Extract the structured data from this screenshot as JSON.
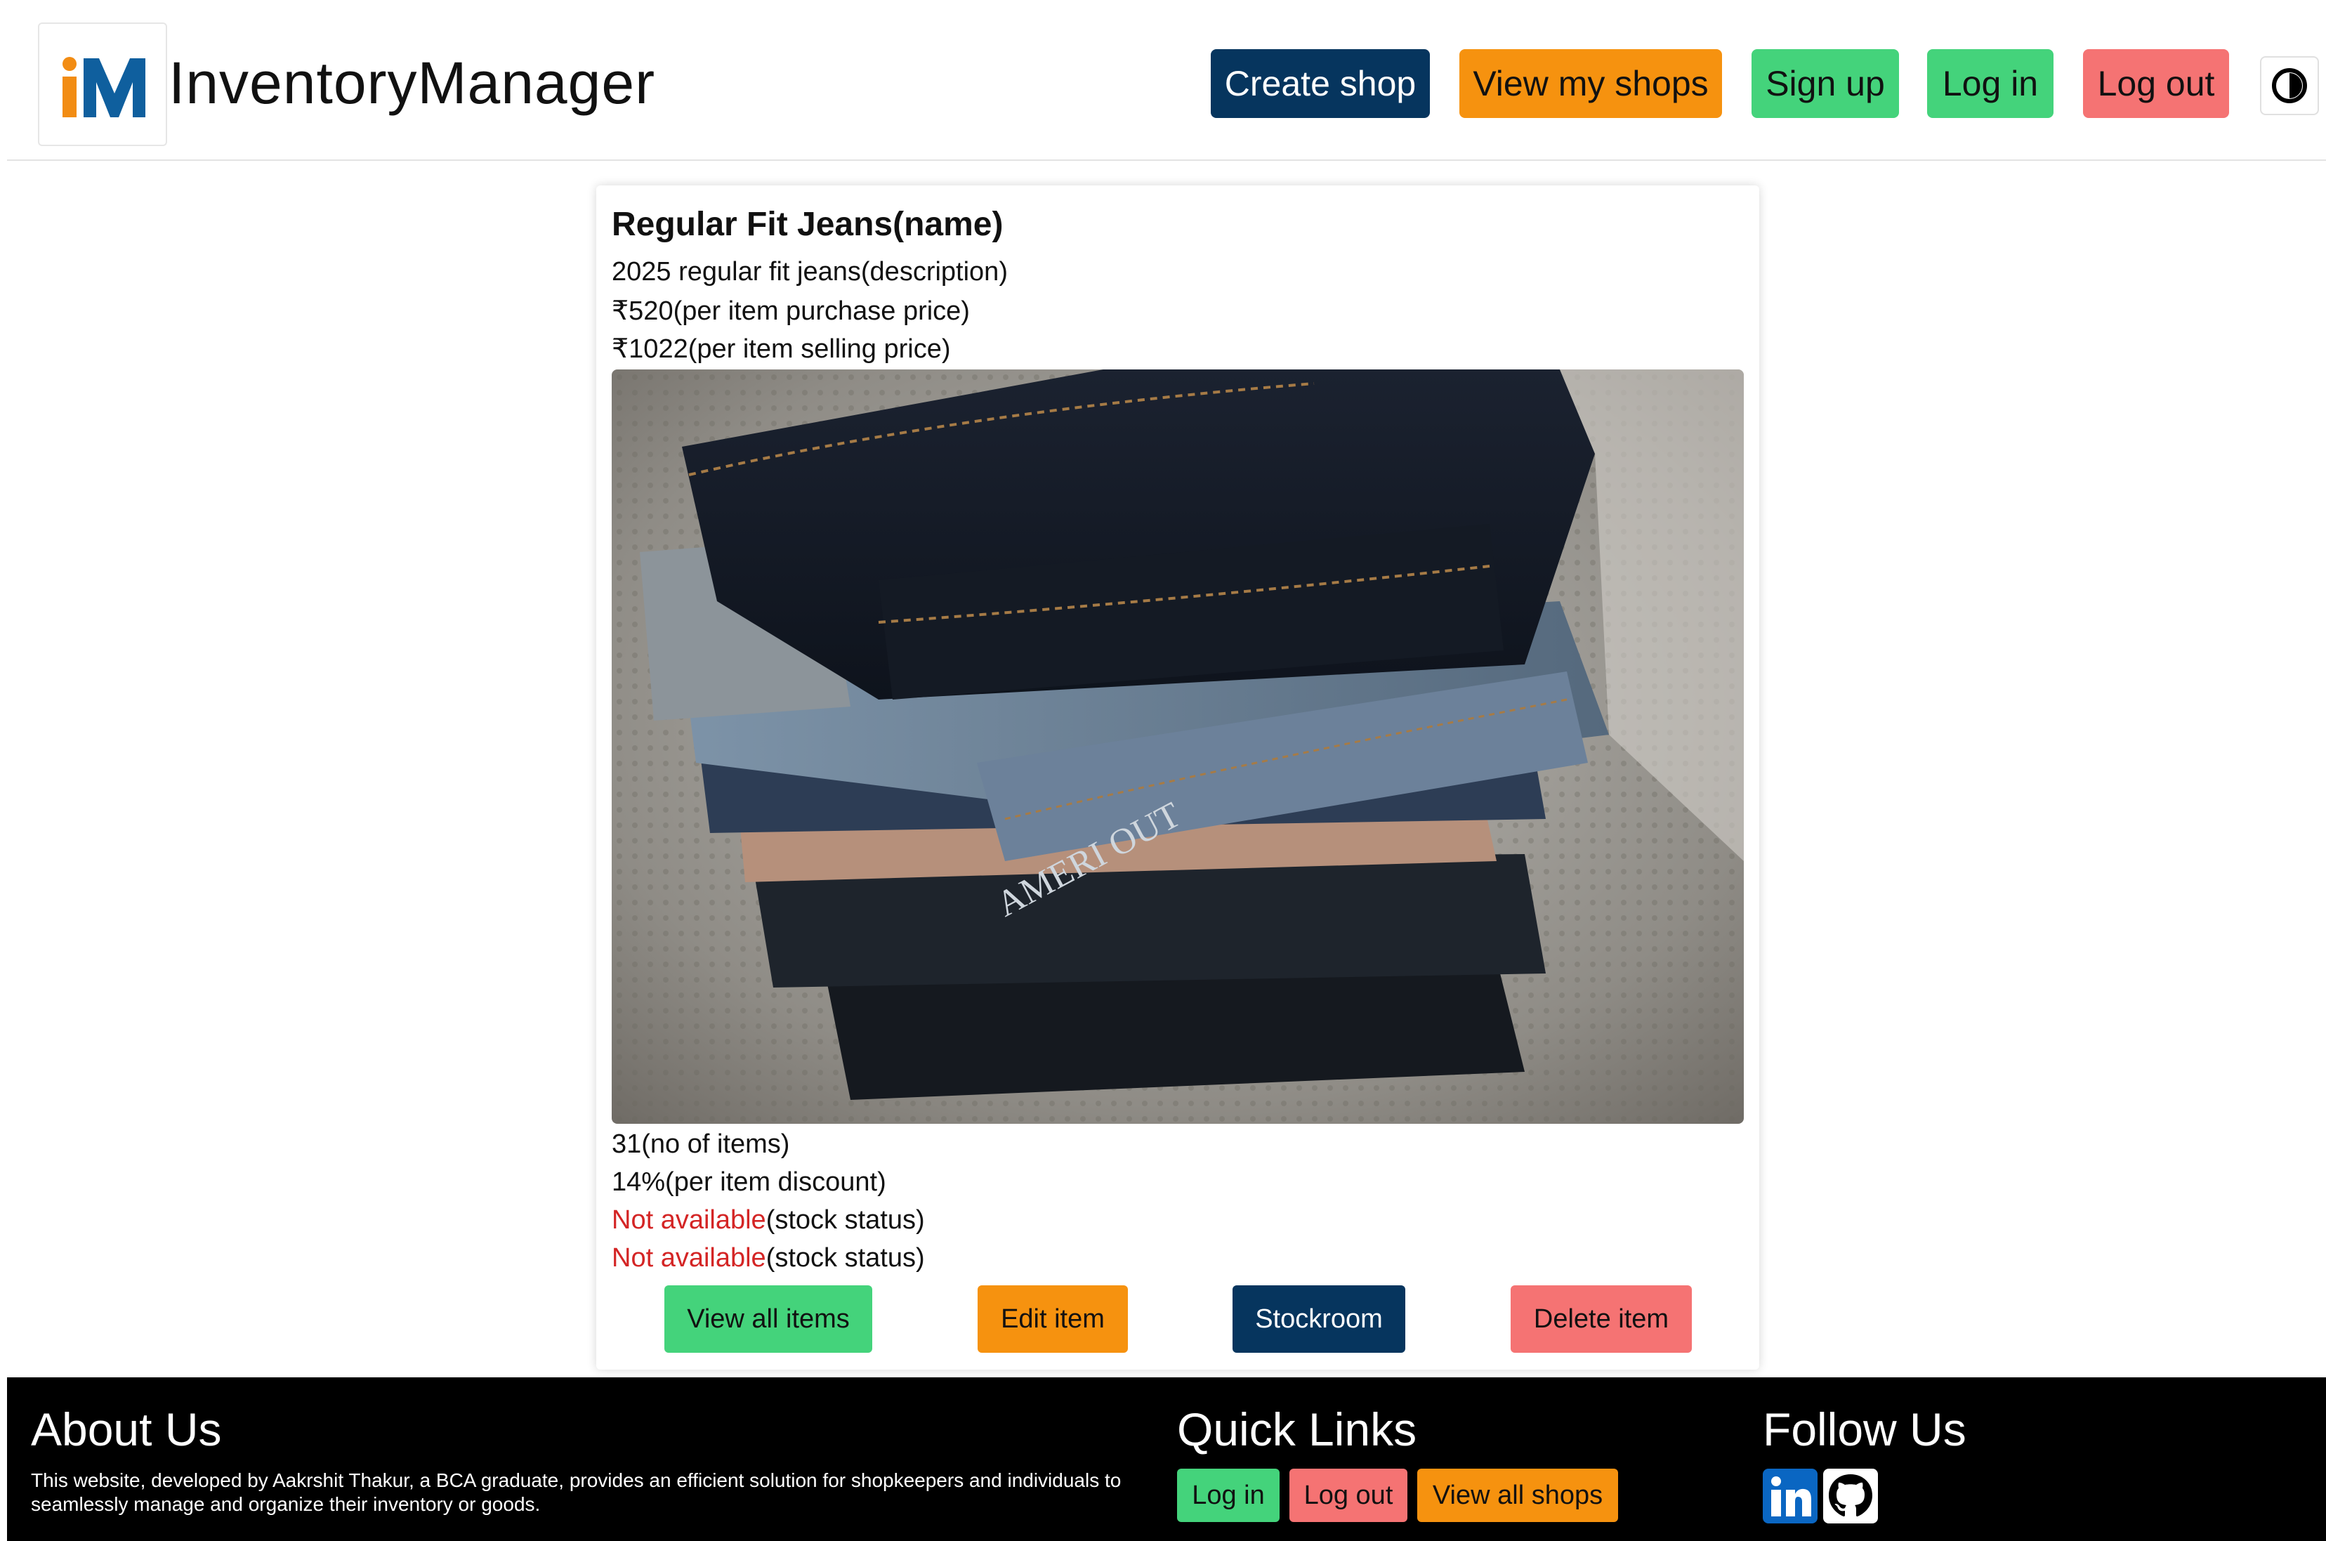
{
  "header": {
    "brand": "InventoryManager",
    "logo_text": "iM",
    "nav": {
      "create_shop": "Create shop",
      "view_my_shops": "View my shops",
      "sign_up": "Sign up",
      "log_in": "Log in",
      "log_out": "Log out"
    },
    "theme_toggle_icon": "contrast-icon"
  },
  "item": {
    "name": "Regular Fit Jeans(name)",
    "description": "2025 regular fit jeans(description)",
    "purchase_price": "₹520(per item purchase price)",
    "selling_price": "₹1022(per item selling price)",
    "image_subject": "stack of folded jeans",
    "image_print": "AMERI OUT",
    "quantity": "31(no of items)",
    "discount": "14%(per item discount)",
    "stock_status_1": {
      "value": "Not available",
      "suffix": "(stock status)"
    },
    "stock_status_2": {
      "value": "Not available",
      "suffix": "(stock status)"
    }
  },
  "actions": {
    "view_all_items": "View all items",
    "edit_item": "Edit item",
    "stockroom": "Stockroom",
    "delete_item": "Delete item"
  },
  "footer": {
    "about_title": "About Us",
    "about_text": "This website, developed by Aakrshit Thakur, a BCA graduate, provides an efficient solution for shopkeepers and individuals to seamlessly manage and organize their inventory or goods.",
    "quick_links_title": "Quick Links",
    "quick_links": {
      "log_in": "Log in",
      "log_out": "Log out",
      "view_all_shops": "View all shops"
    },
    "follow_title": "Follow Us",
    "social": [
      "linkedin-icon",
      "github-icon"
    ]
  },
  "colors": {
    "navy": "#06355e",
    "orange": "#f6920f",
    "green": "#44d37b",
    "red": "#f57373",
    "status_red": "#d42525",
    "logo_orange": "#f28c13",
    "logo_blue": "#0f5f9e"
  }
}
